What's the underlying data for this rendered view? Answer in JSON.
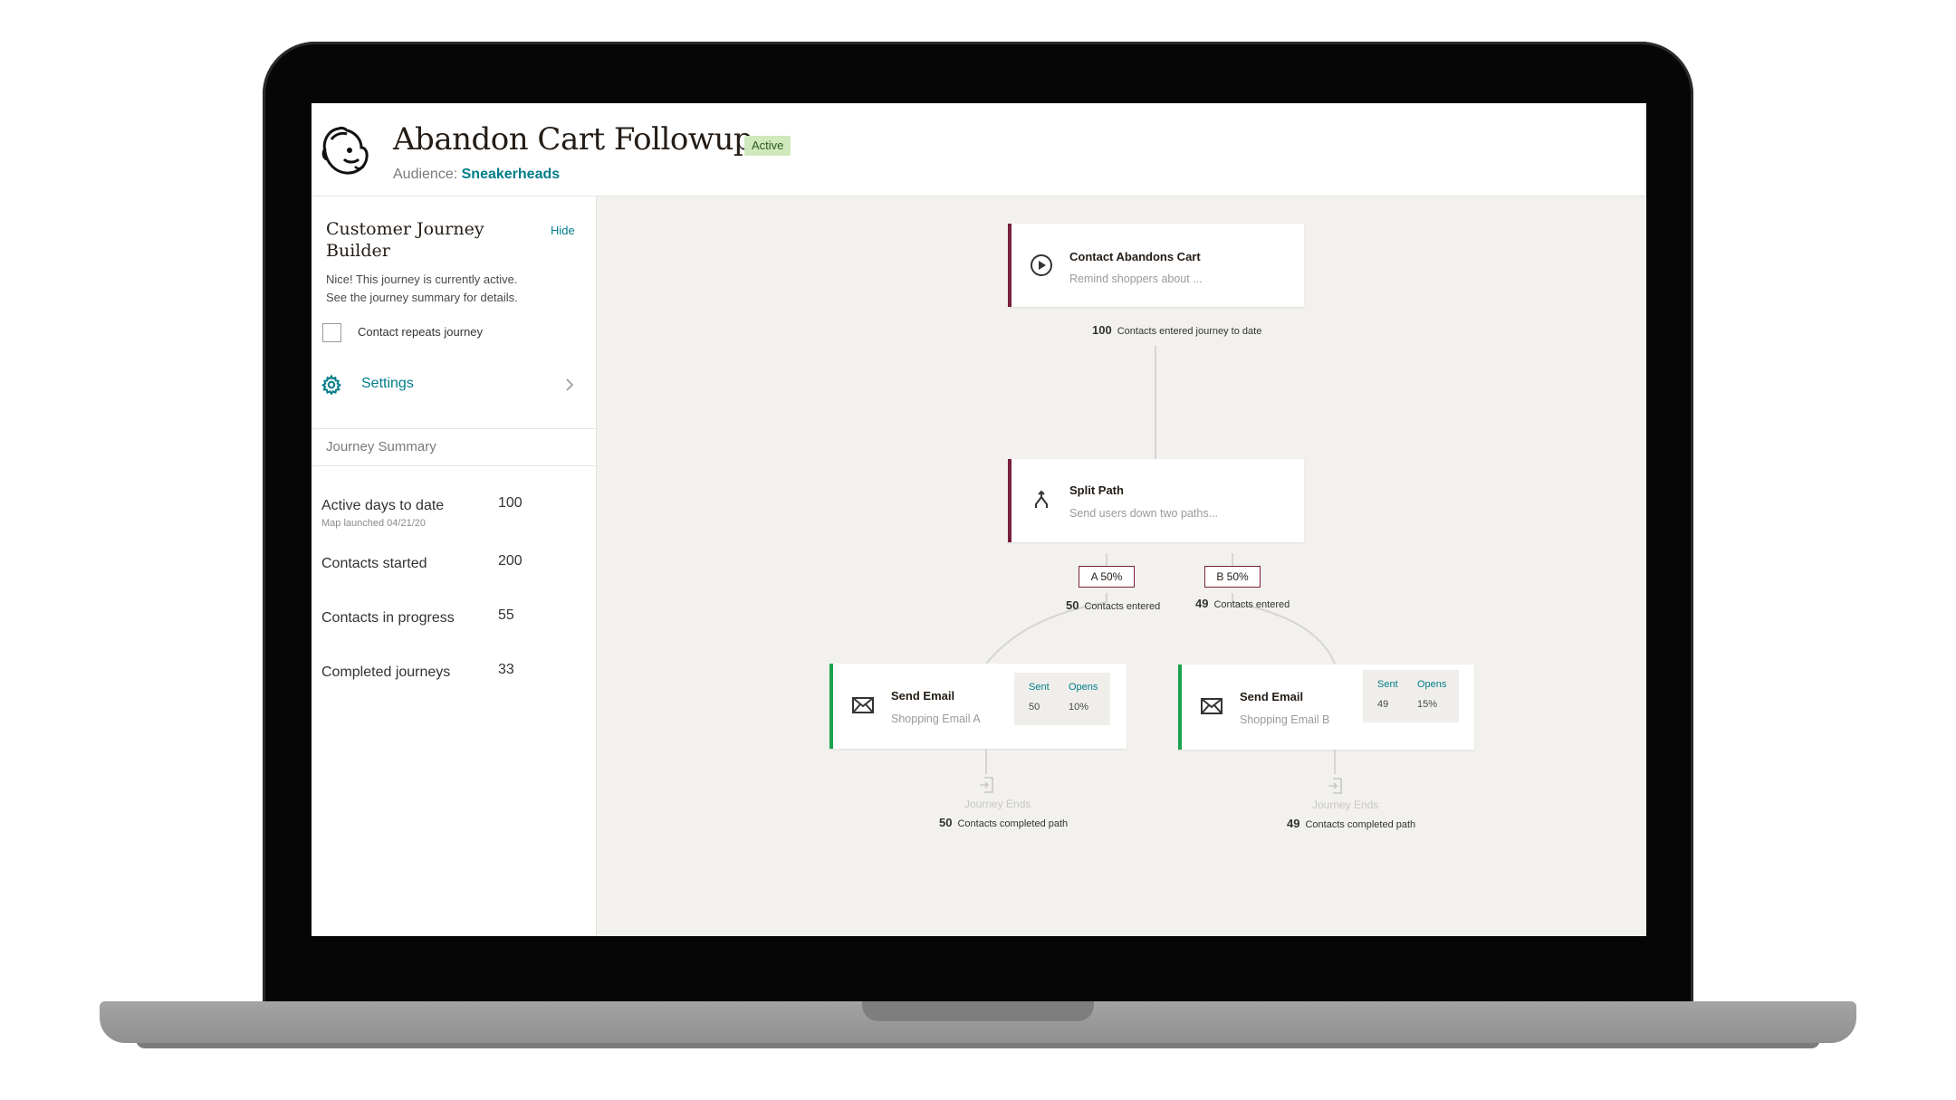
{
  "header": {
    "title": "Abandon Cart Followup",
    "status": "Active",
    "audience_label": "Audience:",
    "audience_name": "Sneakerheads"
  },
  "sidebar": {
    "title": "Customer Journey Builder",
    "hide_label": "Hide",
    "description_line1": "Nice! This journey is currently active.",
    "description_line2": "See the journey summary for details.",
    "checkbox_label": "Contact repeats journey",
    "settings_label": "Settings",
    "summary_header": "Journey Summary",
    "stats": [
      {
        "label": "Active days to date",
        "sub": "Map launched 04/21/20",
        "value": "100"
      },
      {
        "label": "Contacts started",
        "value": "200"
      },
      {
        "label": "Contacts in progress",
        "value": "55"
      },
      {
        "label": "Completed journeys",
        "value": "33"
      }
    ]
  },
  "canvas": {
    "trigger": {
      "title": "Contact Abandons Cart",
      "subtitle": "Remind shoppers about ...",
      "count": "100",
      "count_label": "Contacts entered journey to date"
    },
    "split": {
      "title": "Split Path",
      "subtitle": "Send users down two paths...",
      "branch_a": {
        "label": "A 50%",
        "count": "50",
        "count_label": "Contacts entered"
      },
      "branch_b": {
        "label": "B 50%",
        "count": "49",
        "count_label": "Contacts entered"
      }
    },
    "email_a": {
      "title": "Send Email",
      "subtitle": "Shopping Email A",
      "sent_label": "Sent",
      "opens_label": "Opens",
      "sent": "50",
      "opens": "10%",
      "end_label": "Journey Ends",
      "end_count": "50",
      "end_count_label": "Contacts completed path"
    },
    "email_b": {
      "title": "Send Email",
      "subtitle": "Shopping Email B",
      "sent_label": "Sent",
      "opens_label": "Opens",
      "sent": "49",
      "opens": "15%",
      "end_label": "Journey Ends",
      "end_count": "49",
      "end_count_label": "Contacts completed path"
    }
  },
  "colors": {
    "brand_teal": "#007c89",
    "trigger_accent": "#7a1f3d",
    "email_accent": "#1ba34e",
    "badge_bg": "#cfe8bc",
    "canvas_bg": "#f2f1ed"
  },
  "icons": [
    "mailchimp-logo-icon",
    "gear-icon",
    "chevron-right-icon",
    "play-circle-icon",
    "split-arrows-icon",
    "envelope-icon",
    "exit-icon"
  ]
}
